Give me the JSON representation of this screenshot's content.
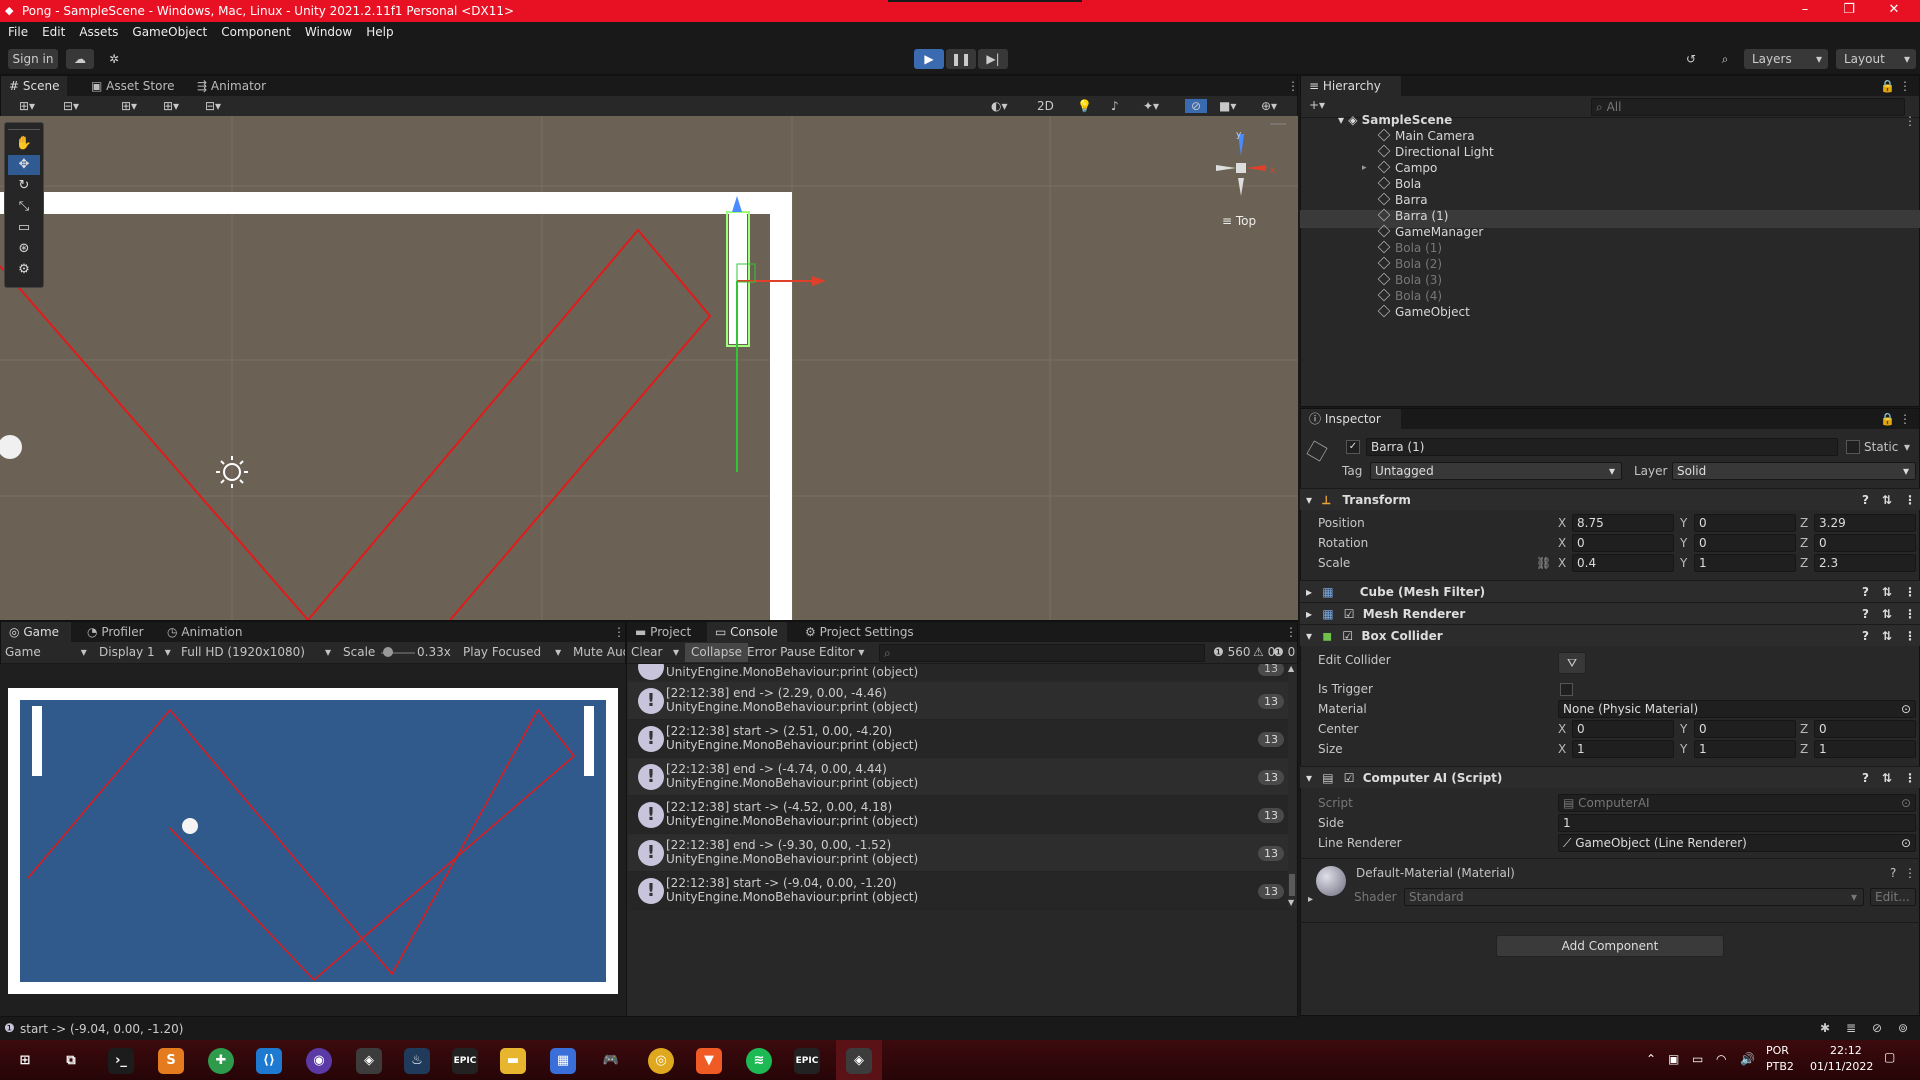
{
  "window": {
    "title": "Pong - SampleScene - Windows, Mac, Linux - Unity 2021.2.11f1 Personal <DX11>",
    "minimize_glyph": "–",
    "maximize_glyph": "❐",
    "close_glyph": "✕"
  },
  "menu": [
    "File",
    "Edit",
    "Assets",
    "GameObject",
    "Component",
    "Window",
    "Help"
  ],
  "toolbar": {
    "sign_in": "Sign in",
    "layers": "Layers",
    "layout": "Layout"
  },
  "scene_panel": {
    "tabs": [
      "Scene",
      "Asset Store",
      "Animator"
    ],
    "btn_2d": "2D",
    "view_label": "≡ Top",
    "gizmo_x": "x",
    "gizmo_y": "y"
  },
  "hierarchy": {
    "tab": "Hierarchy",
    "search_placeholder": "All",
    "scene": "SampleScene",
    "items": [
      {
        "name": "Main Camera",
        "active": true,
        "expandable": false
      },
      {
        "name": "Directional Light",
        "active": true,
        "expandable": false
      },
      {
        "name": "Campo",
        "active": true,
        "expandable": true
      },
      {
        "name": "Bola",
        "active": true,
        "expandable": false
      },
      {
        "name": "Barra",
        "active": true,
        "expandable": false
      },
      {
        "name": "Barra (1)",
        "active": true,
        "expandable": false,
        "selected": true
      },
      {
        "name": "GameManager",
        "active": true,
        "expandable": false
      },
      {
        "name": "Bola (1)",
        "active": false,
        "expandable": false
      },
      {
        "name": "Bola (2)",
        "active": false,
        "expandable": false
      },
      {
        "name": "Bola (3)",
        "active": false,
        "expandable": false
      },
      {
        "name": "Bola (4)",
        "active": false,
        "expandable": false
      },
      {
        "name": "GameObject",
        "active": true,
        "expandable": false
      }
    ]
  },
  "inspector": {
    "tab": "Inspector",
    "object_name": "Barra (1)",
    "static_label": "Static",
    "tag_label": "Tag",
    "tag_value": "Untagged",
    "layer_label": "Layer",
    "layer_value": "Solid",
    "transform": {
      "title": "Transform",
      "position_label": "Position",
      "rotation_label": "Rotation",
      "scale_label": "Scale",
      "position": {
        "x": "8.75",
        "y": "0",
        "z": "3.29"
      },
      "rotation": {
        "x": "0",
        "y": "0",
        "z": "0"
      },
      "scale": {
        "x": "0.4",
        "y": "1",
        "z": "2.3"
      }
    },
    "mesh_filter": "Cube (Mesh Filter)",
    "mesh_renderer": "Mesh Renderer",
    "box_collider": {
      "title": "Box Collider",
      "edit_collider": "Edit Collider",
      "is_trigger": "Is Trigger",
      "material_label": "Material",
      "material_value": "None (Physic Material)",
      "center_label": "Center",
      "center": {
        "x": "0",
        "y": "0",
        "z": "0"
      },
      "size_label": "Size",
      "size": {
        "x": "1",
        "y": "1",
        "z": "1"
      }
    },
    "computer_ai": {
      "title": "Computer AI (Script)",
      "script_label": "Script",
      "script_value": "ComputerAI",
      "side_label": "Side",
      "side_value": "1",
      "line_renderer_label": "Line Renderer",
      "line_renderer_value": "GameObject (Line Renderer)"
    },
    "material": {
      "name": "Default-Material (Material)",
      "shader_label": "Shader",
      "shader_value": "Standard",
      "edit": "Edit..."
    },
    "add_component": "Add Component",
    "axis_x": "X",
    "axis_y": "Y",
    "axis_z": "Z"
  },
  "game_panel": {
    "tabs": [
      "Game",
      "Profiler",
      "Animation"
    ],
    "game_dropdown": "Game",
    "display": "Display 1",
    "resolution": "Full HD (1920x1080)",
    "scale_label": "Scale",
    "scale_value": "0.33x",
    "play_focused": "Play Focused",
    "mute": "Mute Audio"
  },
  "console_panel": {
    "tabs": [
      "Project",
      "Console",
      "Project Settings"
    ],
    "clear": "Clear",
    "collapse": "Collapse",
    "error_pause": "Error Pause",
    "editor": "Editor",
    "info_count": "560",
    "warn_count": "0",
    "error_count": "0",
    "top_partial": "UnityEngine.MonoBehaviour:print (object)",
    "top_partial_count": "13",
    "entries": [
      {
        "line1": "[22:12:38] end -> (2.29, 0.00, -4.46)",
        "line2": "UnityEngine.MonoBehaviour:print (object)",
        "count": "13"
      },
      {
        "line1": "[22:12:38] start -> (2.51, 0.00, -4.20)",
        "line2": "UnityEngine.MonoBehaviour:print (object)",
        "count": "13"
      },
      {
        "line1": "[22:12:38] end -> (-4.74, 0.00, 4.44)",
        "line2": "UnityEngine.MonoBehaviour:print (object)",
        "count": "13"
      },
      {
        "line1": "[22:12:38] start -> (-4.52, 0.00, 4.18)",
        "line2": "UnityEngine.MonoBehaviour:print (object)",
        "count": "13"
      },
      {
        "line1": "[22:12:38] end -> (-9.30, 0.00, -1.52)",
        "line2": "UnityEngine.MonoBehaviour:print (object)",
        "count": "13"
      },
      {
        "line1": "[22:12:38] start -> (-9.04, 0.00, -1.20)",
        "line2": "UnityEngine.MonoBehaviour:print (object)",
        "count": "13"
      }
    ]
  },
  "status_bar": {
    "message": "start -> (-9.04, 0.00, -1.20)"
  },
  "taskbar": {
    "lang1": "POR",
    "lang2": "PTB2",
    "time": "22:12",
    "date": "01/11/2022",
    "epic1": "EPIC",
    "epic2": "EPIC"
  },
  "colors": {
    "titlebar": "#e81123",
    "scene_bg": "#6b6255",
    "game_bg": "#315a8c",
    "trajectory": "#e21a1a",
    "accent": "#2f5a92"
  }
}
